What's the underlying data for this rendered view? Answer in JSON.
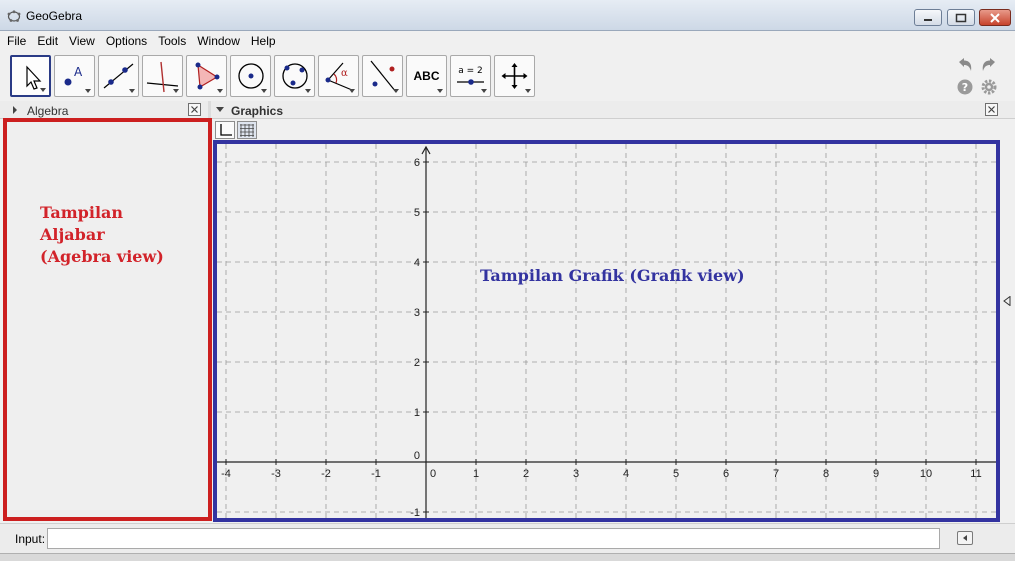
{
  "window": {
    "title": "GeoGebra",
    "controls": {
      "minimize": "minimize",
      "maximize": "maximize",
      "close": "close"
    }
  },
  "menu": [
    "File",
    "Edit",
    "View",
    "Options",
    "Tools",
    "Window",
    "Help"
  ],
  "toolbar": {
    "tools": [
      {
        "name": "move-tool",
        "icon": "arrow-cursor-icon"
      },
      {
        "name": "point-tool",
        "icon": "point-icon",
        "glyph": "A"
      },
      {
        "name": "line-tool",
        "icon": "line-through-points-icon"
      },
      {
        "name": "perpendicular-line-tool",
        "icon": "perpendicular-line-icon"
      },
      {
        "name": "polygon-tool",
        "icon": "polygon-icon"
      },
      {
        "name": "circle-tool",
        "icon": "circle-center-point-icon"
      },
      {
        "name": "circle-three-points-tool",
        "icon": "circle-three-points-icon"
      },
      {
        "name": "angle-tool",
        "icon": "angle-icon",
        "glyph": "α"
      },
      {
        "name": "reflect-tool",
        "icon": "reflect-about-line-icon"
      },
      {
        "name": "text-tool",
        "icon": "text-icon",
        "label": "ABC"
      },
      {
        "name": "slider-tool",
        "icon": "slider-icon",
        "label": "a = 2"
      },
      {
        "name": "move-graphics-tool",
        "icon": "move-graphics-view-icon"
      }
    ],
    "undo_icon": "undo-icon",
    "redo_icon": "redo-icon",
    "help_icon": "help-icon",
    "settings_icon": "gear-icon"
  },
  "algebra": {
    "title": "Algebra",
    "note_lines": [
      "Tampilan",
      "Aljabar",
      "(Agebra view)"
    ],
    "colors": {
      "frame": "#cc1f1f",
      "note": "#d2232a"
    }
  },
  "graphics": {
    "title": "Graphics",
    "note": "Tampilan  Grafik (Grafik view)",
    "colors": {
      "frame": "#3333a0",
      "grid": "#9a9a9a",
      "axis": "#222222"
    },
    "axes": {
      "x_ticks": [
        -4,
        -3,
        -2,
        -1,
        0,
        1,
        2,
        3,
        4,
        5,
        6,
        7,
        8,
        9,
        10,
        11
      ],
      "y_ticks": [
        -1,
        0,
        1,
        2,
        3,
        4,
        5,
        6
      ],
      "grid": true
    }
  },
  "input": {
    "label": "Input:",
    "value": "",
    "placeholder": ""
  }
}
